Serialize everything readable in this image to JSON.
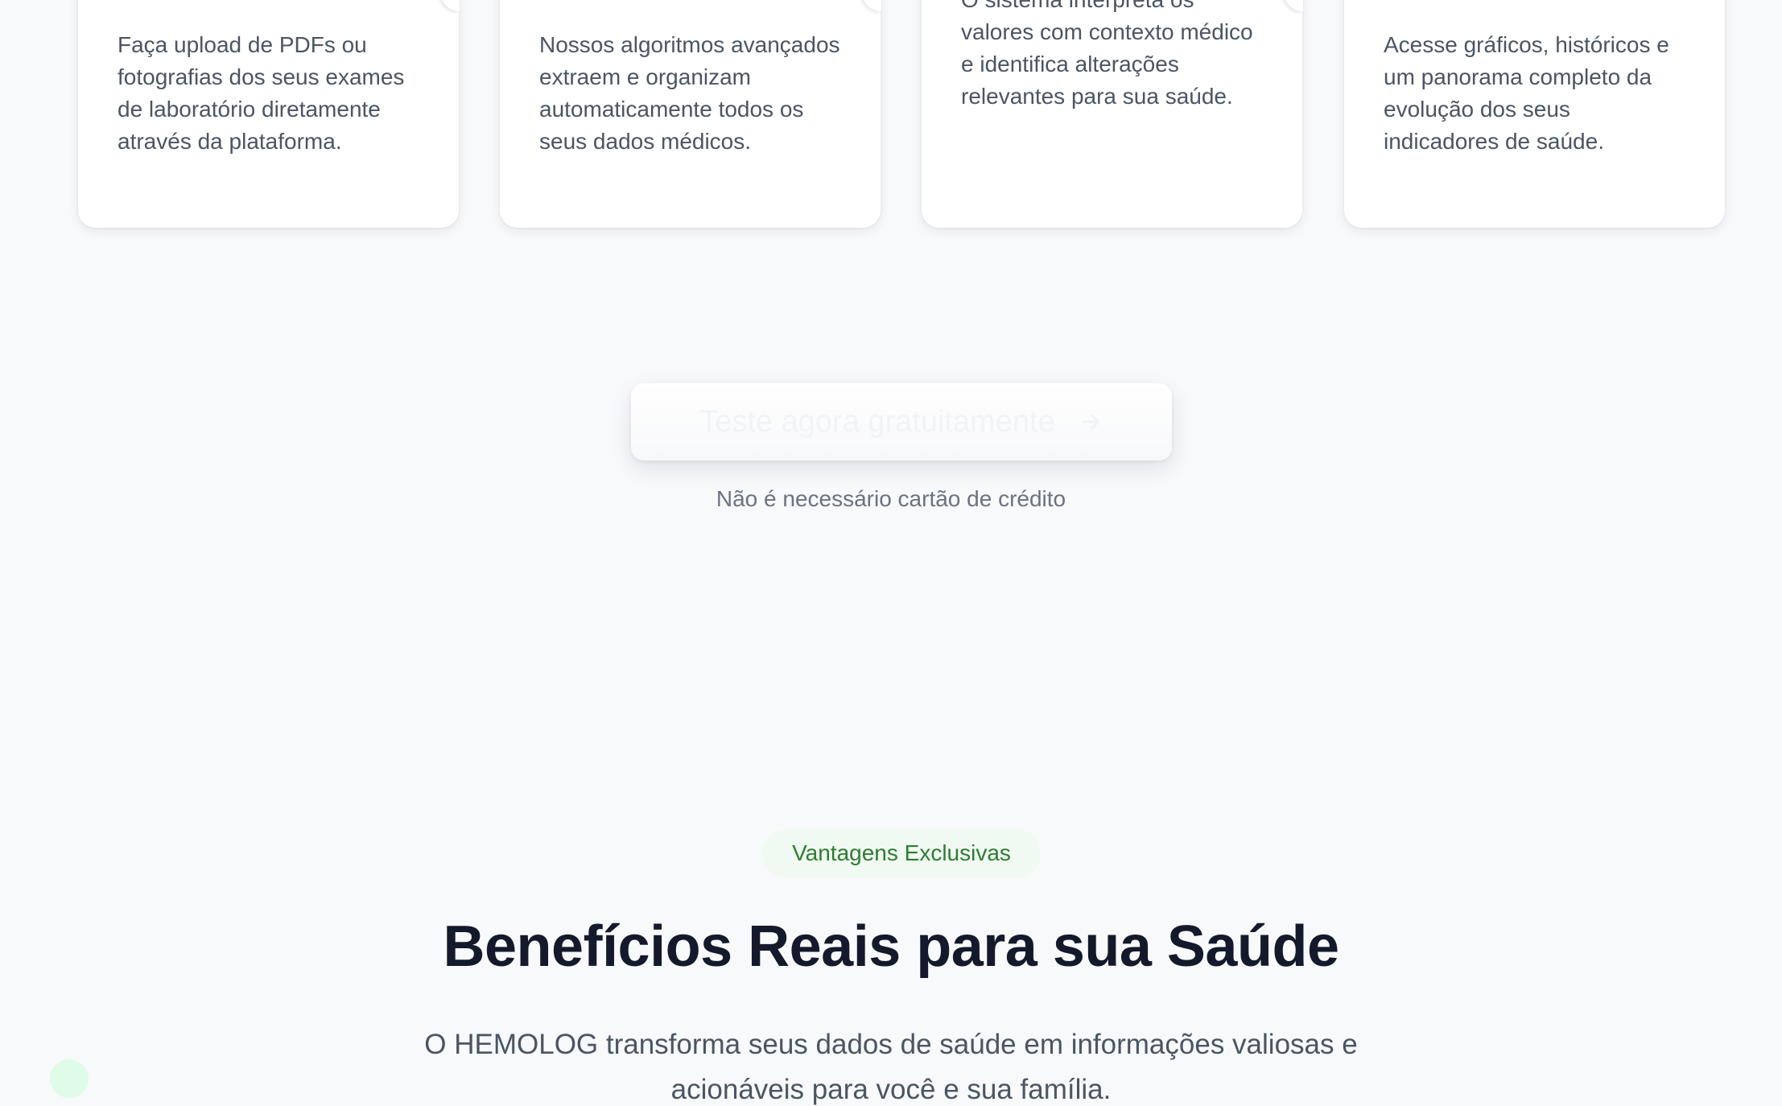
{
  "steps": [
    {
      "title": "",
      "text": "Faça upload de PDFs ou fotografias dos seus exames de laboratório diretamente através da plataforma."
    },
    {
      "title": "",
      "text": "Nossos algoritmos avançados extraem e organizam automaticamente todos os seus dados médicos."
    },
    {
      "title": "",
      "text": "O sistema interpreta os valores com contexto médico e identifica alterações relevantes para sua saúde."
    },
    {
      "title": "",
      "text": "Acesse gráficos, históricos e um panorama completo da evolução dos seus indicadores de saúde."
    }
  ],
  "cta": {
    "label": "Teste agora gratuitamente",
    "icon": "arrow-right-icon",
    "note": "Não é necessário cartão de crédito"
  },
  "benefits": {
    "badge": "Vantagens Exclusivas",
    "title": "Benefícios Reais para sua Saúde",
    "description": "O HEMOLOG transforma seus dados de saúde em informações valiosas e acionáveis para você e sua família."
  },
  "colors": {
    "background": "#f8f9fb",
    "badge_bg": "#f1faf2",
    "badge_text": "#2e7d32",
    "title": "#141a2b",
    "body_text": "#4b5563",
    "muted_text": "#6b7280"
  }
}
